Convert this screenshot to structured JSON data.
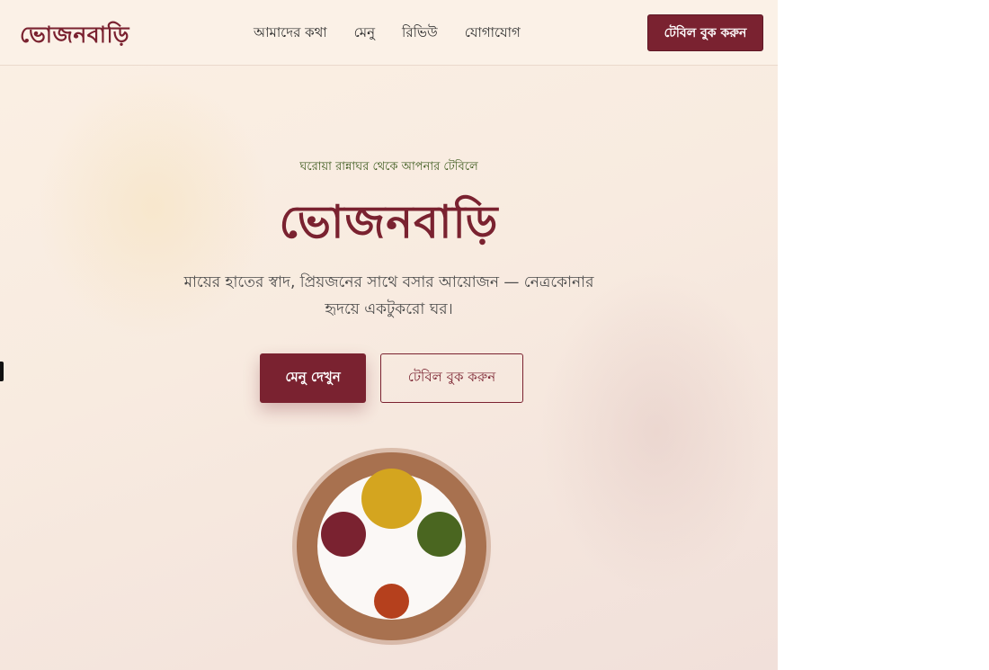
{
  "header": {
    "brand": "ভোজনবাড়ি",
    "nav": [
      "আমাদের কথা",
      "মেনু",
      "রিভিউ",
      "যোগাযোগ"
    ],
    "cta_label": "টেবিল বুক করুন"
  },
  "hero": {
    "kicker": "ঘরোয়া রান্নাঘর থেকে আপনার টেবিলে",
    "title": "ভোজনবাড়ি",
    "tagline": "মায়ের হাতের স্বাদ, প্রিয়জনের সাথে বসার আয়োজন — নেত্রকোনার হৃদয়ে একটুকরো ঘর।",
    "primary_button": "মেনু দেখুন",
    "secondary_button": "টেবিল বুক করুন"
  },
  "colors": {
    "accent": "#7a2230",
    "green": "#3d5a1e",
    "background": "#fbf0e4",
    "plate_rim": "#a8714f",
    "bowl_yellow": "#d4a51f",
    "bowl_green": "#4a6620",
    "bowl_orange": "#b5401d"
  }
}
